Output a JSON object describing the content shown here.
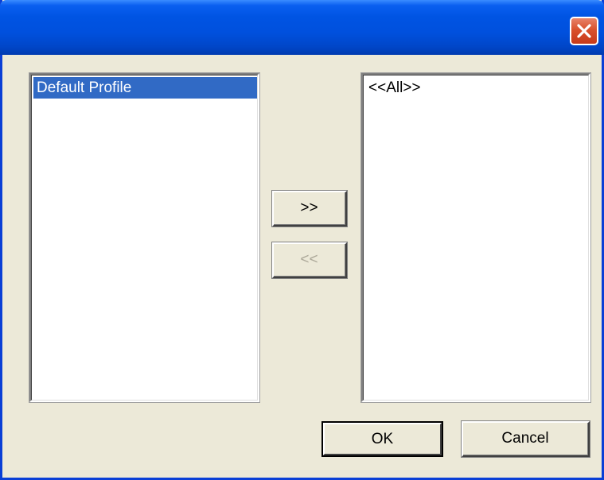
{
  "window": {
    "title": ""
  },
  "left_list": {
    "items": [
      {
        "label": "Default Profile",
        "selected": true
      }
    ]
  },
  "right_list": {
    "items": [
      {
        "label": "<<All>>",
        "selected": false
      }
    ]
  },
  "buttons": {
    "add_label": ">>",
    "remove_label": "<<",
    "ok_label": "OK",
    "cancel_label": "Cancel"
  },
  "colors": {
    "title_bar": "#0054e3",
    "selection": "#316ac5",
    "dialog_bg": "#ece9d8",
    "close_button": "#d9512c"
  }
}
